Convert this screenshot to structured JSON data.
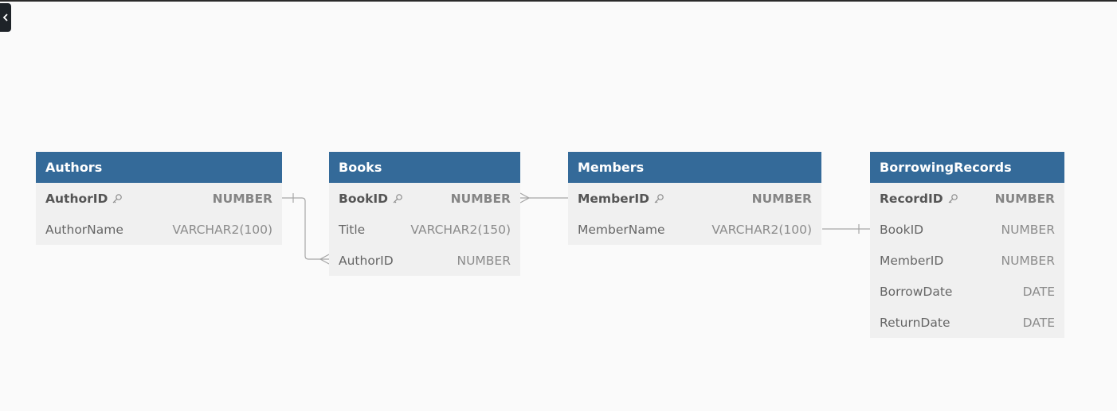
{
  "diagram": {
    "tables": [
      {
        "id": "authors",
        "name": "Authors",
        "columns": [
          {
            "name": "AuthorID",
            "type": "NUMBER",
            "pk": true,
            "icon": "key-icon"
          },
          {
            "name": "AuthorName",
            "type": "VARCHAR2(100)",
            "pk": false
          }
        ]
      },
      {
        "id": "books",
        "name": "Books",
        "columns": [
          {
            "name": "BookID",
            "type": "NUMBER",
            "pk": true,
            "icon": "key-icon"
          },
          {
            "name": "Title",
            "type": "VARCHAR2(150)",
            "pk": false
          },
          {
            "name": "AuthorID",
            "type": "NUMBER",
            "pk": false
          }
        ]
      },
      {
        "id": "members",
        "name": "Members",
        "columns": [
          {
            "name": "MemberID",
            "type": "NUMBER",
            "pk": true,
            "icon": "key-icon"
          },
          {
            "name": "MemberName",
            "type": "VARCHAR2(100)",
            "pk": false
          }
        ]
      },
      {
        "id": "borrowingrecords",
        "name": "BorrowingRecords",
        "columns": [
          {
            "name": "RecordID",
            "type": "NUMBER",
            "pk": true,
            "icon": "key-icon"
          },
          {
            "name": "BookID",
            "type": "NUMBER",
            "pk": false
          },
          {
            "name": "MemberID",
            "type": "NUMBER",
            "pk": false
          },
          {
            "name": "BorrowDate",
            "type": "DATE",
            "pk": false
          },
          {
            "name": "ReturnDate",
            "type": "DATE",
            "pk": false
          }
        ]
      }
    ],
    "relationships": [
      {
        "from": "Authors.AuthorID",
        "to": "Books.AuthorID",
        "from_end": "one",
        "to_end": "many"
      },
      {
        "from": "Books.BookID",
        "to": "Members.MemberID",
        "from_end": "many",
        "to_end": "none"
      },
      {
        "from": "Members.MemberName",
        "to": "BorrowingRecords.BookID",
        "from_end": "none",
        "to_end": "one"
      }
    ]
  },
  "ui": {
    "collapse_button_icon": "chevron-left-icon"
  },
  "colors": {
    "header": "#346a99",
    "header_text": "#ffffff",
    "body": "#f0f0f0",
    "canvas": "#fafafa",
    "connector": "#a6a6a6"
  }
}
